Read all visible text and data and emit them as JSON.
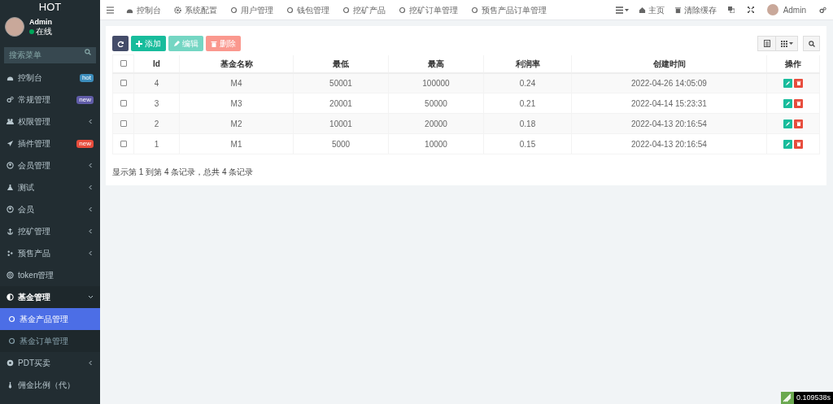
{
  "sidebar": {
    "logo": "HOT",
    "user": {
      "name": "Admin",
      "status": "在线",
      "online": true
    },
    "search": {
      "placeholder": "搜索菜单"
    },
    "items": [
      {
        "label": "控制台",
        "kind": "dashboard",
        "badge": {
          "text": "hot",
          "color": "#3c8dbc"
        },
        "expandable": false,
        "expanded": false,
        "selected": false
      },
      {
        "label": "常规管理",
        "kind": "cogs",
        "badge": {
          "text": "new",
          "color": "#605ca8"
        },
        "expandable": false,
        "expanded": false,
        "selected": false
      },
      {
        "label": "权限管理",
        "kind": "users",
        "expandable": true,
        "expanded": false,
        "selected": false
      },
      {
        "label": "插件管理",
        "kind": "rocket",
        "badge": {
          "text": "new",
          "color": "#e74c3c"
        },
        "expandable": false,
        "expanded": false,
        "selected": false
      },
      {
        "label": "会员管理",
        "kind": "user",
        "expandable": true,
        "expanded": false,
        "selected": false
      },
      {
        "label": "测试",
        "kind": "flask",
        "expandable": true,
        "expanded": false,
        "selected": false
      },
      {
        "label": "会员",
        "kind": "user",
        "expandable": true,
        "expanded": false,
        "selected": false
      },
      {
        "label": "挖矿管理",
        "kind": "anchor",
        "expandable": true,
        "expanded": false,
        "selected": false
      },
      {
        "label": "预售产品",
        "kind": "leaf",
        "expandable": true,
        "expanded": false,
        "selected": false
      },
      {
        "label": "token管理",
        "kind": "target",
        "expandable": false,
        "expanded": false,
        "selected": false
      },
      {
        "label": "基金管理",
        "kind": "half",
        "expandable": true,
        "expanded": true,
        "selected": false,
        "children": [
          {
            "label": "基金产品管理",
            "kind": "circle",
            "selected": true
          },
          {
            "label": "基金订单管理",
            "kind": "circle",
            "selected": false
          }
        ]
      },
      {
        "label": "PDT买卖",
        "kind": "disc",
        "expandable": true,
        "expanded": false,
        "selected": false
      },
      {
        "label": "佣金比例（代）",
        "kind": "tie",
        "expandable": false,
        "expanded": false,
        "selected": false
      }
    ]
  },
  "topnav": {
    "tabs": [
      {
        "label": "控制台",
        "kind": "dashboard"
      },
      {
        "label": "系统配置",
        "kind": "gear"
      },
      {
        "label": "用户管理",
        "kind": "circle"
      },
      {
        "label": "钱包管理",
        "kind": "circle"
      },
      {
        "label": "挖矿产品",
        "kind": "circle"
      },
      {
        "label": "挖矿订单管理",
        "kind": "circle"
      },
      {
        "label": "预售产品订单管理",
        "kind": "circle"
      }
    ],
    "right": [
      {
        "label": "主页",
        "kind": "home"
      },
      {
        "label": "清除缓存",
        "kind": "trash"
      }
    ],
    "user": "Admin"
  },
  "toolbar": [
    {
      "kind": "refresh"
    },
    {
      "kind": "add",
      "label": "添加",
      "disabled": false
    },
    {
      "kind": "edit",
      "label": "编辑",
      "disabled": true
    },
    {
      "kind": "delete",
      "label": "删除",
      "disabled": true
    }
  ],
  "table": {
    "all_selected": false,
    "columns": [
      "Id",
      "基金名称",
      "最低",
      "最高",
      "利润率",
      "创建时间",
      "操作"
    ],
    "rows": [
      {
        "selected": false,
        "cells": [
          "4",
          "M4",
          "50001",
          "100000",
          "0.24",
          "2022-04-26 14:05:09"
        ]
      },
      {
        "selected": false,
        "cells": [
          "3",
          "M3",
          "20001",
          "50000",
          "0.21",
          "2022-04-14 15:23:31"
        ]
      },
      {
        "selected": false,
        "cells": [
          "2",
          "M2",
          "10001",
          "20000",
          "0.18",
          "2022-04-13 20:16:54"
        ]
      },
      {
        "selected": false,
        "cells": [
          "1",
          "M1",
          "5000",
          "10000",
          "0.15",
          "2022-04-13 20:16:54"
        ]
      }
    ]
  },
  "pagination_info": "显示第 1 到第 4 条记录，总共 4 条记录",
  "timing": "0.109538s"
}
